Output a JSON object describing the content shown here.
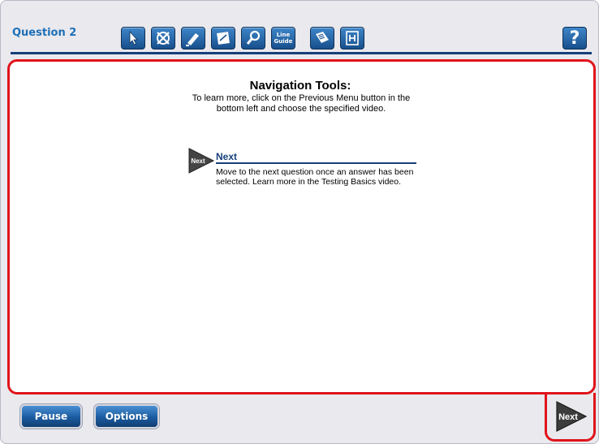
{
  "header": {
    "question_title": "Question 2",
    "tools": [
      {
        "icon": "pointer-icon"
      },
      {
        "icon": "eliminator-icon"
      },
      {
        "icon": "highlighter-icon"
      },
      {
        "icon": "notepad-icon"
      },
      {
        "icon": "magnifier-icon"
      },
      {
        "label": "Line Guide",
        "line1": "Line",
        "line2": "Guide"
      },
      {
        "icon": "reference-sheet-icon"
      },
      {
        "icon": "formula-icon"
      }
    ],
    "help_label": "?"
  },
  "panel": {
    "heading": "Navigation Tools:",
    "subtitle": "To learn more, click on the Previous Menu button in the bottom left and choose the specified video.",
    "next_item": {
      "badge_label": "Next",
      "title": "Next",
      "description": "Move to the next question once an answer has been selected. Learn more in the Testing Basics video."
    }
  },
  "footer": {
    "pause_label": "Pause",
    "options_label": "Options",
    "next_label": "Next"
  },
  "colors": {
    "accent": "#1e6fb5",
    "highlight": "#e0141b",
    "navy": "#163f7a"
  }
}
